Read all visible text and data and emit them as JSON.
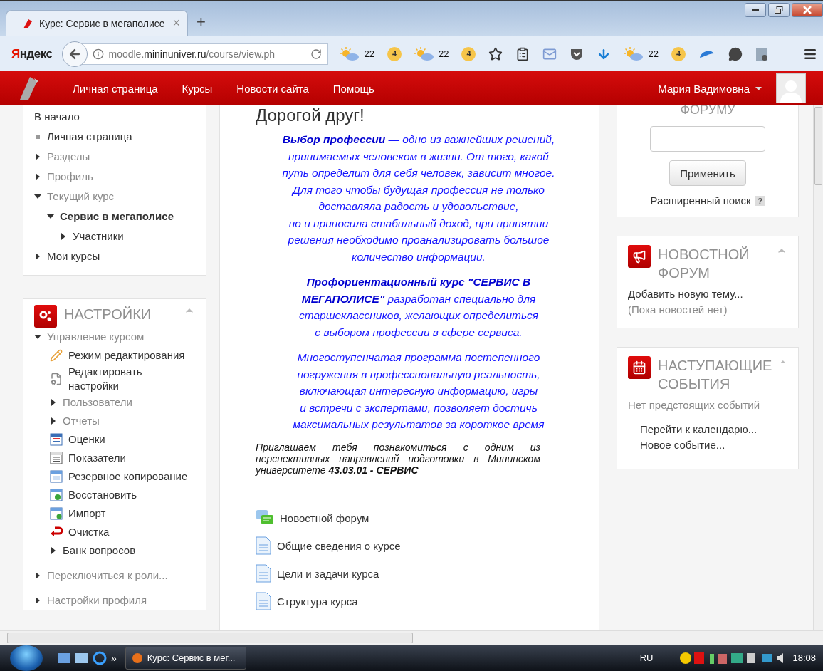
{
  "browser": {
    "tab_title": "Курс: Сервис в мегаполисе",
    "tab_close": "×",
    "new_tab": "+",
    "brand": "Яндекс",
    "url": {
      "prefix": "moodle.",
      "domain": "mininuniver.ru",
      "path": "/course/view.ph"
    },
    "toolbar": [
      {
        "kind": "weather",
        "text": "22"
      },
      {
        "kind": "badge",
        "text": "4"
      },
      {
        "kind": "weather",
        "text": "22"
      },
      {
        "kind": "badge",
        "text": "4"
      },
      {
        "kind": "star"
      },
      {
        "kind": "reader"
      },
      {
        "kind": "mail"
      },
      {
        "kind": "pocket"
      },
      {
        "kind": "download"
      },
      {
        "kind": "weather",
        "text": "22"
      },
      {
        "kind": "badge",
        "text": "4"
      },
      {
        "kind": "cloud"
      },
      {
        "kind": "chat"
      },
      {
        "kind": "extension"
      },
      {
        "kind": "menu"
      }
    ]
  },
  "navbar": {
    "links": [
      "Личная страница",
      "Курсы",
      "Новости сайта",
      "Помощь"
    ],
    "user": "Мария Вадимовна"
  },
  "navigation": {
    "items": [
      {
        "label": "В начало",
        "kind": "plain"
      },
      {
        "label": "Личная страница",
        "kind": "leaf"
      },
      {
        "label": "Разделы",
        "kind": "branch",
        "expanded": false,
        "dim": true
      },
      {
        "label": "Профиль",
        "kind": "branch",
        "expanded": false,
        "dim": true
      },
      {
        "label": "Текущий курс",
        "kind": "branch",
        "expanded": true,
        "dim": true,
        "children": [
          {
            "label": "Сервис в мегаполисе",
            "kind": "branch",
            "expanded": true,
            "dim": false,
            "current": true,
            "children": [
              {
                "label": "Участники",
                "kind": "branch",
                "expanded": false,
                "dim": false
              }
            ]
          }
        ]
      },
      {
        "label": "Мои курсы",
        "kind": "branch",
        "expanded": false,
        "dim": false
      }
    ]
  },
  "settings": {
    "title": "НАСТРОЙКИ",
    "items": [
      {
        "label": "Управление курсом",
        "kind": "branch",
        "expanded": true,
        "dim": true,
        "children": [
          {
            "label": "Режим редактирования",
            "kind": "pencil"
          },
          {
            "label": "Редактировать настройки",
            "kind": "settings"
          },
          {
            "label": "Пользователи",
            "kind": "branch",
            "expanded": false,
            "dim": true
          },
          {
            "label": "Отчеты",
            "kind": "branch",
            "expanded": false,
            "dim": true
          },
          {
            "label": "Оценки",
            "kind": "grades"
          },
          {
            "label": "Показатели",
            "kind": "outcomes"
          },
          {
            "label": "Резервное копирование",
            "kind": "backup"
          },
          {
            "label": "Восстановить",
            "kind": "restore"
          },
          {
            "label": "Импорт",
            "kind": "import"
          },
          {
            "label": "Очистка",
            "kind": "reset"
          },
          {
            "label": "Банк вопросов",
            "kind": "branch",
            "expanded": false,
            "dim": false
          }
        ]
      }
    ],
    "more": [
      {
        "label": "Переключиться к роли...",
        "kind": "branch",
        "expanded": false,
        "dim": true
      },
      {
        "label": "Настройки профиля",
        "kind": "branch",
        "expanded": false,
        "dim": true
      }
    ]
  },
  "content": {
    "heading": "Дорогой друг!",
    "paragraphs": [
      {
        "kind": "intro",
        "text": "**Выбор профессии** — одно из важнейших решений,\nпринимаемых человеком в жизни. От того, какой\nпуть определит для себя человек, зависит многое.\nДля того чтобы будущая профессия не только\nдоставляла радость и удовольствие,\nно и приносила стабильный доход, при принятии\nрешения необходимо проанализировать большое\nколичество информации."
      },
      {
        "kind": "intro",
        "text": "**Профориентационный курс \"СЕРВИС В\nМЕГАПОЛИСЕ\"** разработан специально для\nстаршеклассников, желающих определиться\nс выбором профессии в сфере сервиса."
      },
      {
        "kind": "intro",
        "text": "Многоступенчатая программа постепенного\nпогружения в профессиональную реальность,\nвключающая интересную информацию, игры\nи встречи с экспертами, позволяет достичь\nмаксимальных результатов за короткое время"
      },
      {
        "kind": "invite",
        "text": "Приглашаем тебя познакомиться с одним из перспективных направлений подготовки в Мининском университете  **43.03.01 - СЕРВИС**"
      }
    ],
    "activities": [
      {
        "kind": "forum",
        "label": "Новостной форум"
      },
      {
        "kind": "page",
        "label": "Общие сведения о курсе"
      },
      {
        "kind": "page",
        "label": "Цели и задачи курса"
      },
      {
        "kind": "page",
        "label": "Структура курса"
      }
    ]
  },
  "search_forums": {
    "heading": "ФОРУМУ",
    "button": "Применить",
    "advanced": "Расширенный поиск",
    "help": "?"
  },
  "news": {
    "title": "НОВОСТНОЙ ФОРУМ",
    "add": "Добавить новую тему...",
    "empty": "(Пока новостей нет)"
  },
  "events": {
    "title": "НАСТУПАЮЩИЕ СОБЫТИЯ",
    "empty": "Нет предстоящих событий",
    "links": [
      "Перейти к календарю...",
      "Новое событие..."
    ]
  },
  "taskbar": {
    "chevron": "»",
    "task": "Курс: Сервис в мег...",
    "lang": "RU",
    "clock": "18:08"
  }
}
